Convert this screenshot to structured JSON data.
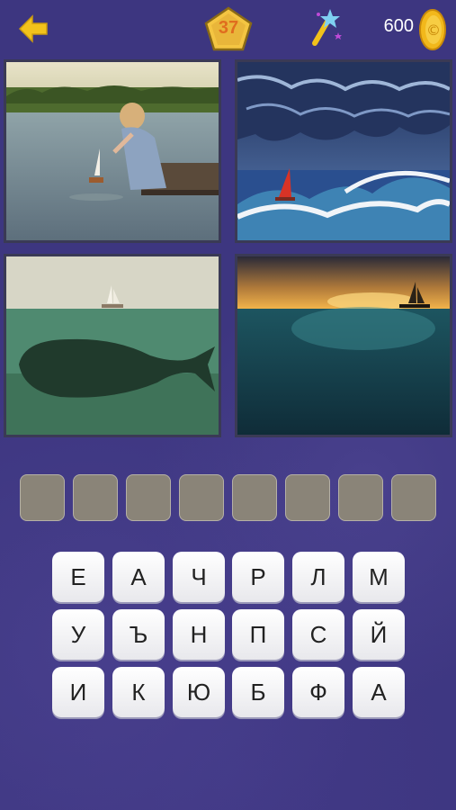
{
  "header": {
    "back_icon": "arrow-left-icon",
    "level": "37",
    "hint_icon": "magic-wand-icon",
    "coins": "600",
    "coin_icon": "coin-icon"
  },
  "images": [
    "girl-toy-boat",
    "stormy-sea-boat",
    "whale-under-boat",
    "sunset-sea-boat"
  ],
  "answer_slots": [
    "",
    "",
    "",
    "",
    "",
    "",
    "",
    ""
  ],
  "letters": [
    [
      "Е",
      "А",
      "Ч",
      "Р",
      "Л",
      "М"
    ],
    [
      "У",
      "Ъ",
      "Н",
      "П",
      "С",
      "Й"
    ],
    [
      "И",
      "К",
      "Ю",
      "Б",
      "Ф",
      "А"
    ]
  ],
  "colors": {
    "accent": "#f2c21b",
    "level_text": "#e06d1e",
    "background": "#3d3680"
  }
}
